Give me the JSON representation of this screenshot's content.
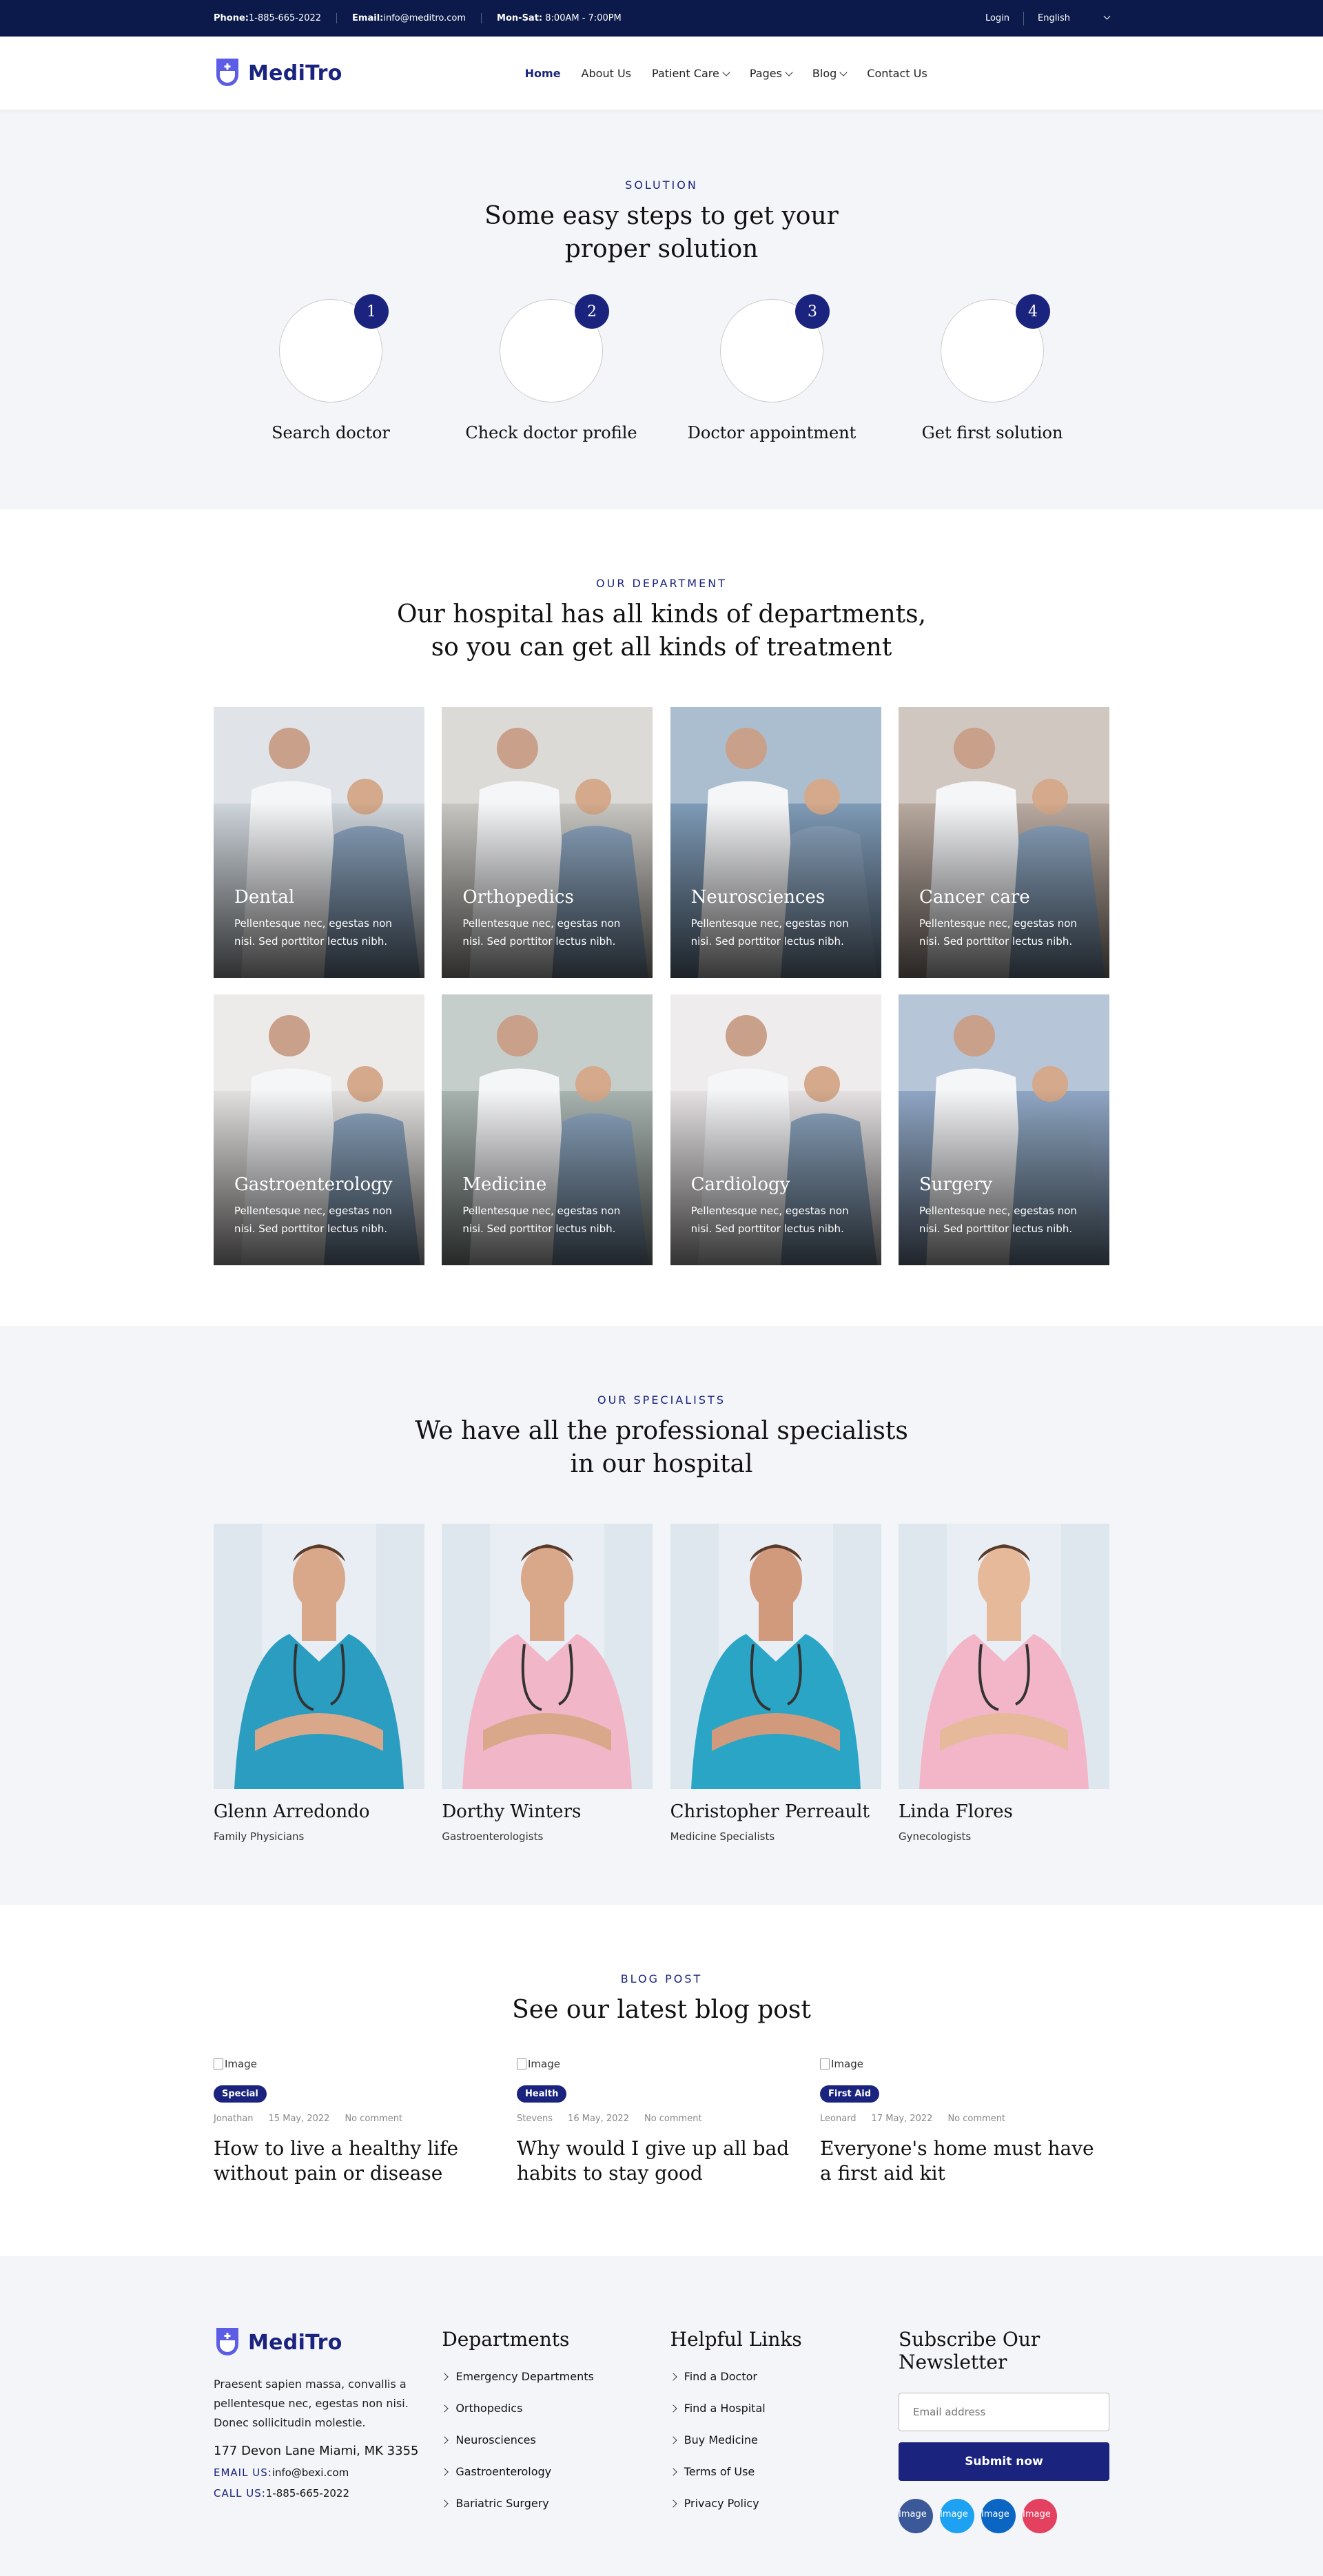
{
  "topbar": {
    "phone_label": "Phone:",
    "phone": "1-885-665-2022",
    "email_label": "Email:",
    "email": "info@meditro.com",
    "hours_label": "Mon-Sat:",
    "hours": "8:00AM - 7:00PM",
    "login": "Login",
    "language": "English"
  },
  "brand": {
    "name": "MediTro",
    "accent": "#1a237e",
    "logo_color": "#5c5ce6"
  },
  "nav": {
    "home": "Home",
    "about": "About Us",
    "patient_care": "Patient Care",
    "pages": "Pages",
    "blog": "Blog",
    "contact": "Contact Us"
  },
  "steps": {
    "eyebrow": "SOLUTION",
    "title_line1": "Some easy steps to get your",
    "title_line2": "proper solution",
    "items": [
      {
        "num": "1",
        "label": "Search doctor"
      },
      {
        "num": "2",
        "label": "Check doctor profile"
      },
      {
        "num": "3",
        "label": "Doctor appointment"
      },
      {
        "num": "4",
        "label": "Get first solution"
      }
    ]
  },
  "departments": {
    "eyebrow": "OUR DEPARTMENT",
    "title_line1": "Our hospital has all kinds of departments,",
    "title_line2": "so you can get all kinds of treatment",
    "desc": "Pellentesque nec, egestas non nisi. Sed porttitor lectus nibh.",
    "items": [
      {
        "name": "Dental",
        "color": "#cfd6dc"
      },
      {
        "name": "Orthopedics",
        "color": "#c9c7c2"
      },
      {
        "name": "Neurosciences",
        "color": "#7f9bb7"
      },
      {
        "name": "Cancer care",
        "color": "#b9aaa0"
      },
      {
        "name": "Gastroenterology",
        "color": "#e3e1df"
      },
      {
        "name": "Medicine",
        "color": "#a8b4b0"
      },
      {
        "name": "Cardiology",
        "color": "#e6e2e4"
      },
      {
        "name": "Surgery",
        "color": "#8fa6c4"
      }
    ]
  },
  "specialists": {
    "eyebrow": "OUR SPECIALISTS",
    "title_line1": "We have all the professional specialists",
    "title_line2": "in our hospital",
    "items": [
      {
        "name": "Glenn Arredondo",
        "role": "Family Physicians",
        "scrub": "#2a9dc0",
        "skin": "#d9a88a"
      },
      {
        "name": "Dorthy Winters",
        "role": "Gastroenterologists",
        "scrub": "#f1b7c8",
        "skin": "#d9a88a"
      },
      {
        "name": "Christopher Perreault",
        "role": "Medicine Specialists",
        "scrub": "#2aa5c6",
        "skin": "#d29a7c"
      },
      {
        "name": "Linda Flores",
        "role": "Gynecologists",
        "scrub": "#f3b6c9",
        "skin": "#e5b999"
      }
    ]
  },
  "blog": {
    "eyebrow": "BLOG POST",
    "title": "See our latest blog post",
    "posts": [
      {
        "image_alt": "Image",
        "tag": "Special",
        "author": "Jonathan",
        "date": "15 May, 2022",
        "comments": "No comment",
        "title": "How to live a healthy life without pain or disease"
      },
      {
        "image_alt": "Image",
        "tag": "Health",
        "author": "Stevens",
        "date": "16 May, 2022",
        "comments": "No comment",
        "title": "Why would I give up all bad habits to stay good"
      },
      {
        "image_alt": "Image",
        "tag": "First Aid",
        "author": "Leonard",
        "date": "17 May, 2022",
        "comments": "No comment",
        "title": "Everyone's home must have a first aid kit"
      }
    ]
  },
  "footer": {
    "about": "Praesent sapien massa, convallis a pellentesque nec, egestas non nisi. Donec sollicitudin molestie.",
    "address": "177 Devon Lane Miami, MK 3355",
    "email_label": "EMAIL US:",
    "email": "info@bexi.com",
    "call_label": "CALL US:",
    "phone": "1-885-665-2022",
    "departments_title": "Departments",
    "departments": [
      "Emergency Departments",
      "Orthopedics",
      "Neurosciences",
      "Gastroenterology",
      "Bariatric Surgery"
    ],
    "links_title": "Helpful Links",
    "links": [
      "Find a Doctor",
      "Find a Hospital",
      "Buy Medicine",
      "Terms of Use",
      "Privacy Policy"
    ],
    "newsletter_title": "Subscribe Our Newsletter",
    "email_placeholder": "Email address",
    "submit": "Submit now",
    "socials": [
      {
        "alt": "Image",
        "color": "#3b5998"
      },
      {
        "alt": "Image",
        "color": "#1da1f2"
      },
      {
        "alt": "Image",
        "color": "#0a66c2"
      },
      {
        "alt": "Image",
        "color": "#e4405f"
      }
    ]
  }
}
